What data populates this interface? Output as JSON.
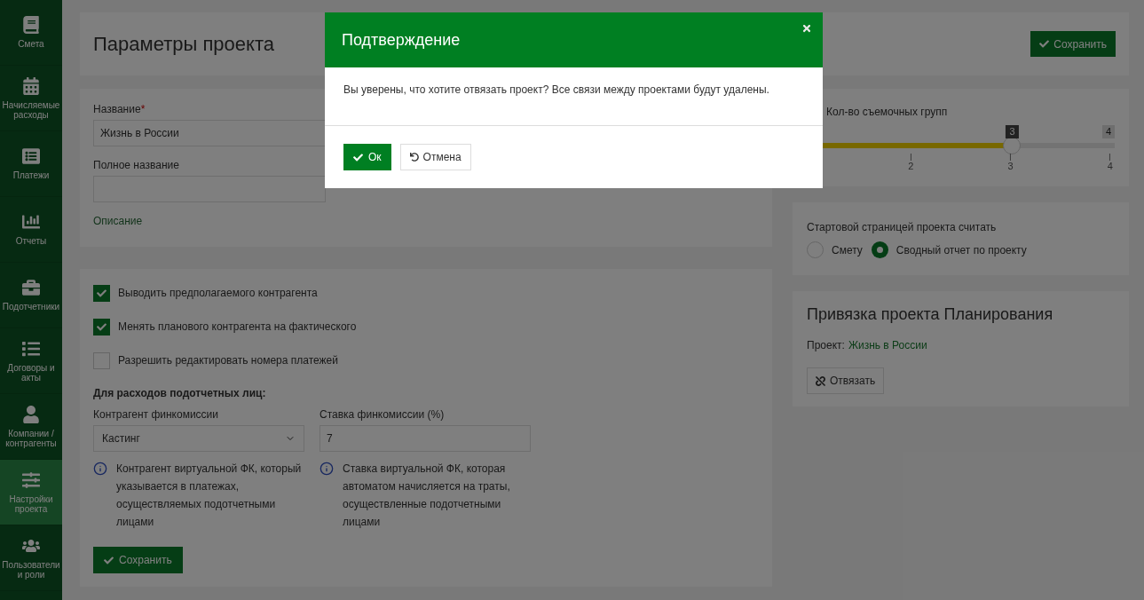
{
  "sidebar": {
    "items": [
      {
        "label": "Смета",
        "selected": false
      },
      {
        "label": "Начисляемые расходы",
        "selected": false
      },
      {
        "label": "Платежи",
        "selected": false
      },
      {
        "label": "Отчеты",
        "selected": false
      },
      {
        "label": "Подотчетники",
        "selected": false
      },
      {
        "label": "Договоры и акты",
        "selected": false
      },
      {
        "label": "Компании / контрагенты",
        "selected": false
      },
      {
        "label": "Настройки проекта",
        "selected": true
      },
      {
        "label": "Пользователи и роли",
        "selected": false
      }
    ]
  },
  "page": {
    "title": "Параметры проекта",
    "save_button": "Сохранить"
  },
  "project_form": {
    "name_label": "Название",
    "required_mark": "*",
    "name_value": "Жизнь в России",
    "full_name_label": "Полное название",
    "description_label": "Описание"
  },
  "options": {
    "checkboxes": [
      {
        "label": "Выводить предполагаемого контрагента",
        "checked": true
      },
      {
        "label": "Менять планового контрагента на фактического",
        "checked": true
      },
      {
        "label": "Разрешить редактировать номера платежей",
        "checked": false
      }
    ],
    "section_heading": "Для расходов подотчетных лиц:",
    "commission_counterparty": {
      "label": "Контрагент финкомиссии",
      "value": "Кастинг",
      "hint": "Контрагент виртуальной ФК, который указывается в платежах, осуществляемых подотчетными лицами"
    },
    "commission_rate": {
      "label": "Ставка финкомиссии (%)",
      "value": "7",
      "hint": "Ставка виртуальной ФК, которая автоматом начисляется на траты, осуществленные подотчетными лицами"
    },
    "save_button": "Сохранить"
  },
  "shooting_groups": {
    "label": "Кол-во съемочных групп",
    "level": 0.667,
    "value_bubble": "3",
    "max_bubble": "4",
    "ticks": [
      "2",
      "3",
      "4"
    ]
  },
  "start_page": {
    "label": "Стартовой страницей проекта считать",
    "options": [
      {
        "label": "Смету",
        "selected": false
      },
      {
        "label": "Сводный отчет по проекту",
        "selected": true
      }
    ]
  },
  "planning_link": {
    "title": "Привязка проекта Планирования",
    "project_label": "Проект:",
    "project_value": "Жизнь в России",
    "unlink_button": "Отвязать"
  },
  "dialog": {
    "title": "Подтверждение",
    "message": "Вы уверены, что хотите отвязать проект? Все связи между проектами будут удалены.",
    "ok_button": "Ок",
    "cancel_button": "Отмена"
  }
}
